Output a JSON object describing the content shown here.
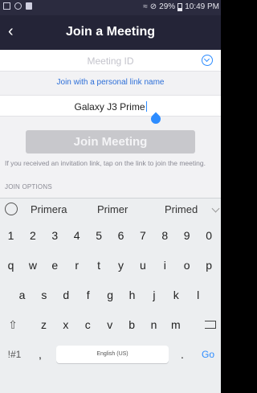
{
  "status_bar": {
    "battery": "29%",
    "time": "10:49 PM",
    "icons": [
      "screenshot-icon",
      "sync-icon",
      "bag-icon",
      "wifi-icon",
      "do-not-disturb-icon",
      "battery-icon"
    ]
  },
  "header": {
    "title": "Join a Meeting",
    "back_icon": "back-chevron-icon"
  },
  "meeting_id": {
    "placeholder": "Meeting ID",
    "dropdown_icon": "chevron-circle-icon"
  },
  "personal_link": "Join with a personal link name",
  "name_field": {
    "value": "Galaxy J3 Prime"
  },
  "join_button": {
    "label": "Join Meeting",
    "enabled": false
  },
  "hint": "If you received an invitation link, tap on the link to join the meeting.",
  "options_header": "JOIN OPTIONS",
  "keyboard": {
    "suggestions": [
      "Primera",
      "Primer",
      "Primed"
    ],
    "row1": [
      "1",
      "2",
      "3",
      "4",
      "5",
      "6",
      "7",
      "8",
      "9",
      "0"
    ],
    "row2": [
      "q",
      "w",
      "e",
      "r",
      "t",
      "y",
      "u",
      "i",
      "o",
      "p"
    ],
    "row3": [
      "a",
      "s",
      "d",
      "f",
      "g",
      "h",
      "j",
      "k",
      "l"
    ],
    "row4": [
      "z",
      "x",
      "c",
      "v",
      "b",
      "n",
      "m"
    ],
    "row5": {
      "symbols": "!#1",
      "comma": ",",
      "space": "English (US)",
      "period": ".",
      "go": "Go"
    },
    "accent": "#2d8cff"
  }
}
